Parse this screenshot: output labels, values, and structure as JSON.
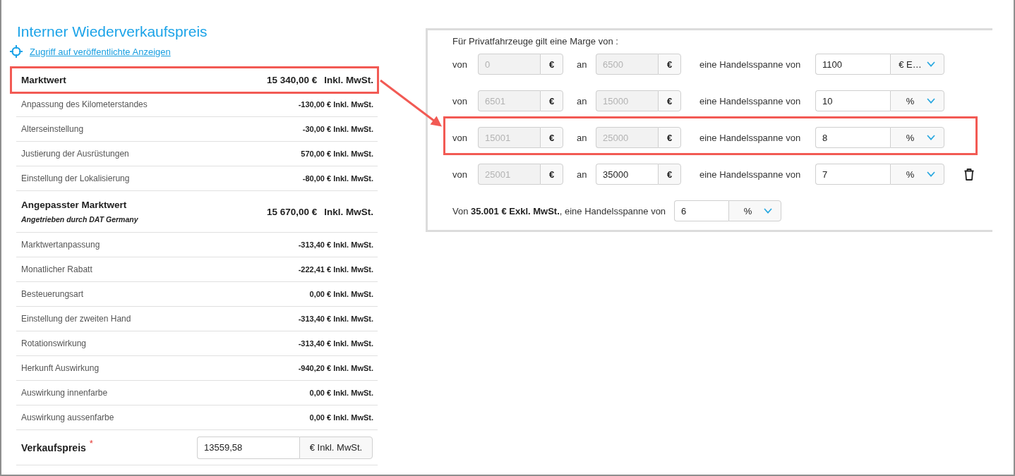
{
  "title": "Interner Wiederverkaufspreis",
  "link": {
    "label": "Zugriff auf veröffentlichte Anzeigen"
  },
  "price_table": {
    "rows": [
      {
        "kind": "total",
        "label": "Marktwert",
        "amount": "15 340,00 €",
        "suffix": "Inkl. MwSt.",
        "highlighted": true
      },
      {
        "kind": "adjustment",
        "label": "Anpassung des Kilometerstandes",
        "value": "-130,00 € Inkl. MwSt.",
        "highlighted": false
      },
      {
        "kind": "adjustment",
        "label": "Alterseinstellung",
        "value": "-30,00 € Inkl. MwSt.",
        "highlighted": false
      },
      {
        "kind": "adjustment",
        "label": "Justierung der Ausrüstungen",
        "value": "570,00 € Inkl. MwSt.",
        "highlighted": false
      },
      {
        "kind": "adjustment",
        "label": "Einstellung der Lokalisierung",
        "value": "-80,00 € Inkl. MwSt.",
        "highlighted": false
      },
      {
        "kind": "total",
        "label": "Angepasster Marktwert",
        "note": "Angetrieben durch DAT Germany",
        "amount": "15 670,00 €",
        "suffix": "Inkl. MwSt.",
        "highlighted": false
      },
      {
        "kind": "adjustment",
        "label": "Marktwertanpassung",
        "value": "-313,40 € Inkl. MwSt.",
        "highlighted": false
      },
      {
        "kind": "adjustment",
        "label": "Monatlicher Rabatt",
        "value": "-222,41 € Inkl. MwSt.",
        "highlighted": false
      },
      {
        "kind": "adjustment",
        "label": "Besteuerungsart",
        "value": "0,00 € Inkl. MwSt.",
        "highlighted": false
      },
      {
        "kind": "adjustment",
        "label": "Einstellung der zweiten Hand",
        "value": "-313,40 € Inkl. MwSt.",
        "highlighted": false
      },
      {
        "kind": "adjustment",
        "label": "Rotationswirkung",
        "value": "-313,40 € Inkl. MwSt.",
        "highlighted": false
      },
      {
        "kind": "adjustment",
        "label": "Herkunft Auswirkung",
        "value": "-940,20 € Inkl. MwSt.",
        "highlighted": false
      },
      {
        "kind": "adjustment",
        "label": "Auswirkung innenfarbe",
        "value": "0,00 € Inkl. MwSt.",
        "highlighted": false
      },
      {
        "kind": "adjustment",
        "label": "Auswirkung aussenfarbe",
        "value": "0,00 € Inkl. MwSt.",
        "highlighted": false
      }
    ]
  },
  "sale_price": {
    "label": "Verkaufspreis",
    "required_mark": "*",
    "field": {
      "value": "13559,58",
      "unit": "€ Inkl. MwSt.",
      "kind": "text",
      "disabled": false
    }
  },
  "margin_panel": {
    "heading": "Für Privatfahrzeuge gilt eine Marge von :",
    "tiers": [
      {
        "from_label": "von",
        "from": {
          "value": "0",
          "unit": "€",
          "kind": "text",
          "disabled": true
        },
        "to_label": "an",
        "to": {
          "value": "6500",
          "unit": "€",
          "kind": "text",
          "disabled": true
        },
        "margin_label": "eine Handelsspanne von",
        "margin": {
          "value": "1100",
          "unit": "€ E…",
          "kind": "select",
          "disabled": false
        },
        "deletable": false,
        "highlighted": false
      },
      {
        "from_label": "von",
        "from": {
          "value": "6501",
          "unit": "€",
          "kind": "text",
          "disabled": true
        },
        "to_label": "an",
        "to": {
          "value": "15000",
          "unit": "€",
          "kind": "text",
          "disabled": true
        },
        "margin_label": "eine Handelsspanne von",
        "margin": {
          "value": "10",
          "unit": "%",
          "kind": "select",
          "disabled": false
        },
        "deletable": false,
        "highlighted": false
      },
      {
        "from_label": "von",
        "from": {
          "value": "15001",
          "unit": "€",
          "kind": "text",
          "disabled": true
        },
        "to_label": "an",
        "to": {
          "value": "25000",
          "unit": "€",
          "kind": "text",
          "disabled": true
        },
        "margin_label": "eine Handelsspanne von",
        "margin": {
          "value": "8",
          "unit": "%",
          "kind": "select",
          "disabled": false
        },
        "deletable": false,
        "highlighted": true
      },
      {
        "from_label": "von",
        "from": {
          "value": "25001",
          "unit": "€",
          "kind": "text",
          "disabled": true
        },
        "to_label": "an",
        "to": {
          "value": "35000",
          "unit": "€",
          "kind": "text",
          "disabled": false
        },
        "margin_label": "eine Handelsspanne von",
        "margin": {
          "value": "7",
          "unit": "%",
          "kind": "select",
          "disabled": false
        },
        "deletable": true,
        "highlighted": false
      }
    ],
    "final": {
      "text": "Von **35.001 € Exkl. MwSt.**, eine Handelsspanne von",
      "margin": {
        "value": "6",
        "unit": "%",
        "kind": "select",
        "disabled": false
      }
    }
  },
  "callout_arrow": true
}
